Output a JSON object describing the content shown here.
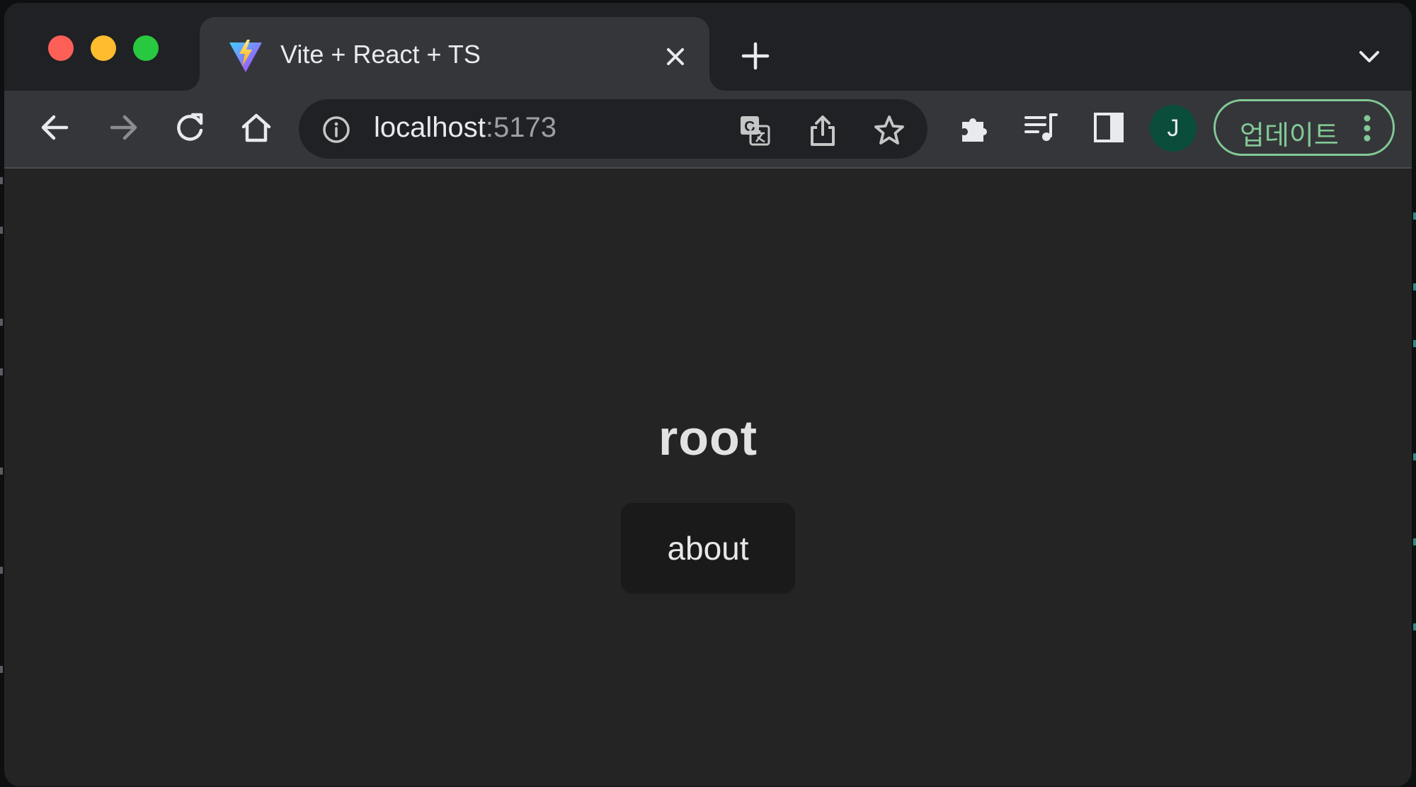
{
  "browser": {
    "tab": {
      "title": "Vite + React + TS",
      "favicon": "vite-logo-icon"
    },
    "address_bar": {
      "host": "localhost",
      "port": ":5173"
    },
    "profile_initial": "J",
    "update_button_label": "업데이트",
    "colors": {
      "frame": "#202124",
      "toolbar": "#35363a",
      "update_accent": "#81c995",
      "avatar": "#0b4d3b"
    }
  },
  "page": {
    "heading": "root",
    "link_button_label": "about",
    "background": "#242424"
  }
}
